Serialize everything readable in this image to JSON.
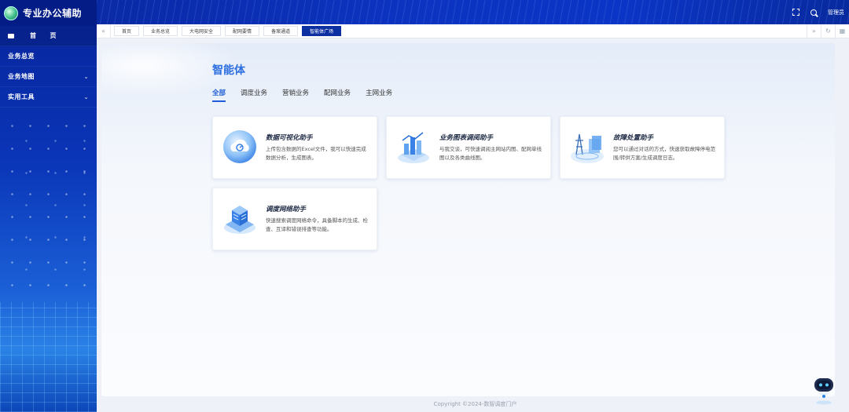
{
  "app": {
    "title": "专业办公辅助"
  },
  "sidebar": {
    "items": [
      {
        "label": "首　　页"
      },
      {
        "label": "业务总览"
      },
      {
        "label": "业务地图"
      },
      {
        "label": "实用工具"
      }
    ]
  },
  "header": {
    "user": "管理员"
  },
  "tabs": [
    {
      "label": "首页"
    },
    {
      "label": "业务总览"
    },
    {
      "label": "大电网安全"
    },
    {
      "label": "配网要情"
    },
    {
      "label": "备案通道"
    },
    {
      "label": "智能体广场"
    }
  ],
  "main": {
    "title": "智能体",
    "categories": [
      "全部",
      "调度业务",
      "营销业务",
      "配网业务",
      "主网业务"
    ],
    "cards": [
      {
        "name": "数据可视化助手",
        "desc": "上传包含数据的Excel文件，我可以快速完成数据分析，生成图表。"
      },
      {
        "name": "业务图表调阅助手",
        "desc": "与我交谈，可快速调阅主网站内图、配网单线图以及各类曲线图。"
      },
      {
        "name": "故障处置助手",
        "desc": "您可以通过对话的方式，快速获取故障停电范围/转供方案/生成调度日志。"
      },
      {
        "name": "调度网络助手",
        "desc": "快速搜索调度网络命令，具备脚本的生成、检查、互译和错误排查等功能。"
      }
    ]
  },
  "footer": {
    "copyright": "Copyright ©2024-数智调度门户"
  },
  "colors": {
    "brand": "#0c2fa2",
    "accent": "#1f5ed8"
  },
  "icons": [
    "globe-logo",
    "home-icon",
    "chevron-down-icon",
    "fullscreen-icon",
    "search-icon",
    "double-left-icon",
    "double-right-icon",
    "refresh-icon",
    "grid-icon",
    "robot-assistant"
  ]
}
